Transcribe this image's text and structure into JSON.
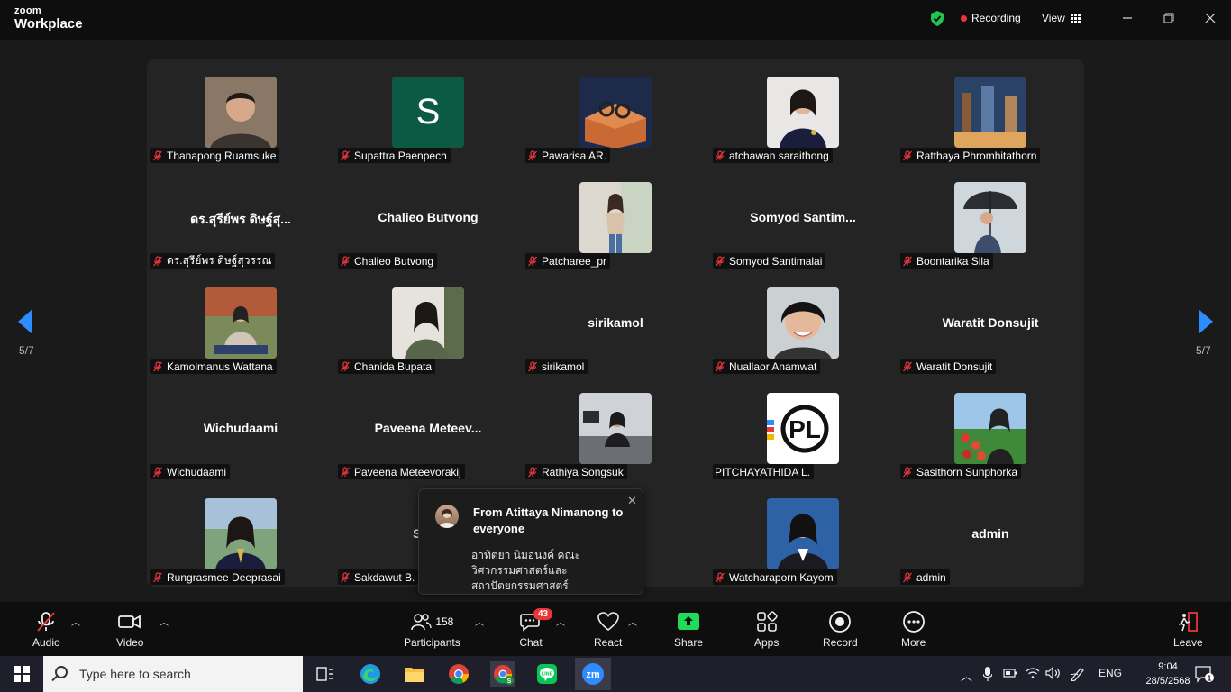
{
  "app": {
    "logo_top": "zoom",
    "logo_bottom": "Workplace"
  },
  "header": {
    "recording_label": "Recording",
    "view_label": "View"
  },
  "pagination": {
    "left": "5/7",
    "right": "5/7"
  },
  "participants": [
    {
      "label": "Thanapong Ruamsuke",
      "display": "photo",
      "muted": true
    },
    {
      "label": "Supattra Paenpech",
      "display": "initial",
      "initial": "S",
      "muted": true
    },
    {
      "label": "Pawarisa AR.",
      "display": "photo",
      "muted": true
    },
    {
      "label": "atchawan saraithong",
      "display": "photo",
      "muted": true
    },
    {
      "label": "Ratthaya Phromhitathorn",
      "display": "photo",
      "muted": true
    },
    {
      "label": "ดร.สุรีย์พร ดิษฐ์สุวรรณ",
      "display": "name",
      "bigname": "ดร.สุรีย์พร ดิษฐ์สุ...",
      "muted": true
    },
    {
      "label": "Chalieo Butvong",
      "display": "name",
      "bigname": "Chalieo Butvong",
      "muted": true
    },
    {
      "label": "Patcharee_pr",
      "display": "photo",
      "muted": true
    },
    {
      "label": "Somyod Santimalai",
      "display": "name",
      "bigname": "Somyod  Santim...",
      "muted": true
    },
    {
      "label": "Boontarika Sila",
      "display": "photo",
      "muted": true
    },
    {
      "label": "Kamolmanus Wattana",
      "display": "photo",
      "muted": true
    },
    {
      "label": "Chanida Bupata",
      "display": "photo",
      "muted": true
    },
    {
      "label": "sirikamol",
      "display": "name",
      "bigname": "sirikamol",
      "muted": true
    },
    {
      "label": "Nuallaor Anamwat",
      "display": "photo",
      "muted": true
    },
    {
      "label": "Waratit Donsujit",
      "display": "name",
      "bigname": "Waratit Donsujit",
      "muted": true
    },
    {
      "label": "Wichudaami",
      "display": "name",
      "bigname": "Wichudaami",
      "muted": true
    },
    {
      "label": "Paveena Meteevorakij",
      "display": "name",
      "bigname": "Paveena  Meteev...",
      "muted": true
    },
    {
      "label": "Rathiya Songsuk",
      "display": "photo",
      "muted": true
    },
    {
      "label": "PITCHAYATHIDA L.",
      "display": "logo",
      "muted": false
    },
    {
      "label": "Sasithorn Sunphorka",
      "display": "photo",
      "muted": true
    },
    {
      "label": "Rungrasmee Deeprasai",
      "display": "photo",
      "muted": true
    },
    {
      "label": "Sakdawut B.",
      "display": "name",
      "bigname": "Sakd",
      "muted": true
    },
    {
      "label": "",
      "display": "hidden",
      "muted": false
    },
    {
      "label": "Watcharaporn Kayom",
      "display": "photo",
      "muted": true
    },
    {
      "label": "admin",
      "display": "name",
      "bigname": "admin",
      "muted": true
    }
  ],
  "chat_popup": {
    "title": "From Atittaya Nimanong to everyone",
    "message": "อาทิตยา นิมอนงค์ คณะวิศวกรรมศาสตร์และสถาปัตยกรรมศาสตร์"
  },
  "toolbar": {
    "audio": "Audio",
    "video": "Video",
    "participants": "Participants",
    "participants_count": "158",
    "chat": "Chat",
    "chat_badge": "43",
    "react": "React",
    "share": "Share",
    "apps": "Apps",
    "record": "Record",
    "more": "More",
    "leave": "Leave"
  },
  "taskbar": {
    "search_placeholder": "Type here to search",
    "language": "ENG",
    "time": "9:04",
    "date": "28/5/2568",
    "notification_count": "1"
  },
  "colors": {
    "accent": "#2d8cff",
    "recording": "#e8363b",
    "share": "#23d959",
    "muted": "#e8363b",
    "badge": "#e8363b"
  }
}
